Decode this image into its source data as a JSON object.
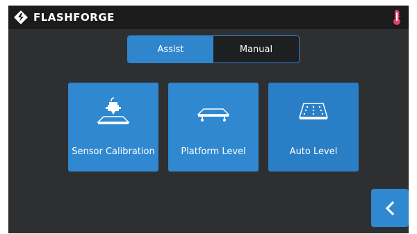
{
  "header": {
    "brand": "FLASHFORGE",
    "brand_icon": "flashforge-logo-icon",
    "temperature_icon": "thermometer-icon"
  },
  "mode_toggle": {
    "options": [
      {
        "label": "Assist",
        "selected": true
      },
      {
        "label": "Manual",
        "selected": false
      }
    ]
  },
  "actions": [
    {
      "label": "Sensor Calibration",
      "icon": "sensor-calibration-icon"
    },
    {
      "label": "Platform Level",
      "icon": "platform-level-icon"
    },
    {
      "label": "Auto Level",
      "icon": "auto-level-icon"
    }
  ],
  "footer": {
    "back_icon": "chevron-left-icon"
  },
  "colors": {
    "accent": "#2f88d0",
    "background": "#2e2f31",
    "topbar": "#1b1b1c",
    "inactive_segment": "#1e1f21",
    "thermometer": "#e0406a"
  }
}
